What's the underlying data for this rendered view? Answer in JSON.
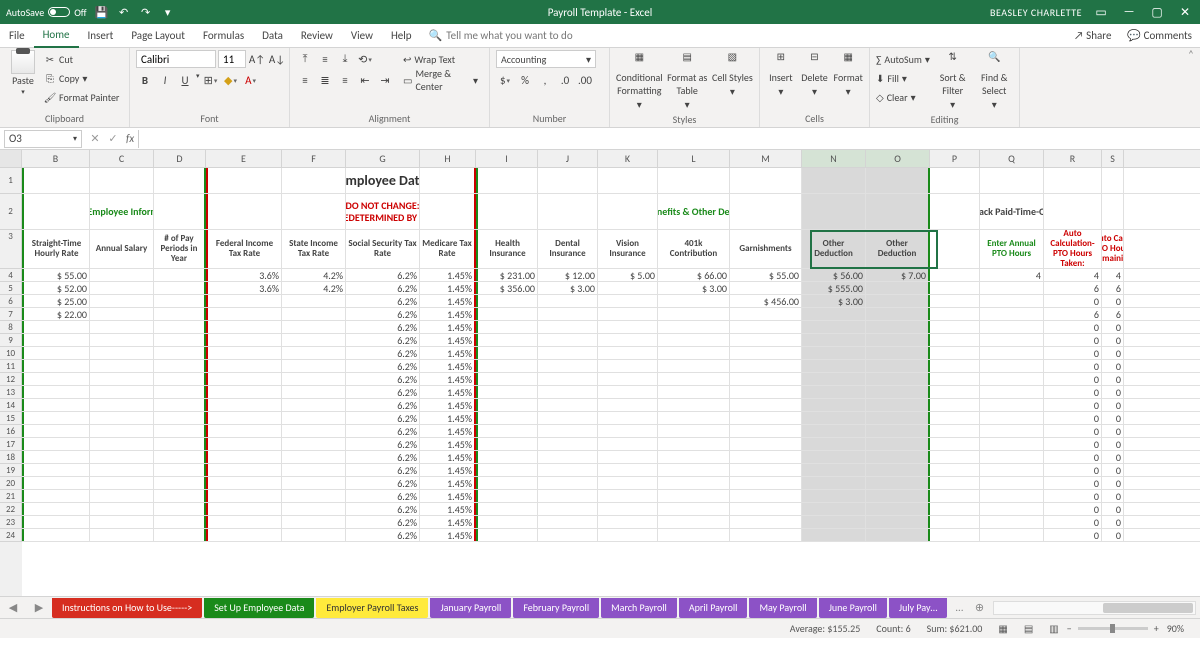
{
  "titlebar": {
    "autosave": "AutoSave",
    "off": "Off",
    "title": "Payroll Template - Excel",
    "user": "BEASLEY CHARLETTE"
  },
  "menu": {
    "file": "File",
    "home": "Home",
    "insert": "Insert",
    "pagelayout": "Page Layout",
    "formulas": "Formulas",
    "data": "Data",
    "review": "Review",
    "view": "View",
    "help": "Help",
    "tell": "Tell me what you want to do",
    "share": "Share",
    "comments": "Comments"
  },
  "ribbon": {
    "clipboard": "Clipboard",
    "paste": "Paste",
    "cut": "Cut",
    "copy": "Copy",
    "fmtpainter": "Format Painter",
    "font": "Font",
    "fontname": "Calibri",
    "fontsize": "11",
    "alignment": "Alignment",
    "wrap": "Wrap Text",
    "merge": "Merge & Center",
    "number": "Number",
    "numfmt": "Accounting",
    "styles": "Styles",
    "cond": "Conditional Formatting",
    "fat": "Format as Table",
    "cstyles": "Cell Styles",
    "cells": "Cells",
    "insert": "Insert",
    "delete": "Delete",
    "format": "Format",
    "editing": "Editing",
    "autosum": "AutoSum",
    "fill": "Fill",
    "clear": "Clear",
    "sort": "Sort & Filter",
    "find": "Find & Select"
  },
  "formula": {
    "name": "O3"
  },
  "cols": [
    "B",
    "C",
    "D",
    "E",
    "F",
    "G",
    "H",
    "I",
    "J",
    "K",
    "L",
    "M",
    "N",
    "O",
    "P",
    "Q",
    "R",
    "S"
  ],
  "headers": {
    "title": "Employee Data",
    "enter_emp": "Enter Employee Information",
    "dnc1": "DO NOT CHANGE:",
    "dnc2": "PREDETERMINED BY IRS",
    "enter_ben": "Enter Benefits & Other Deductions",
    "track_pto": "Track Paid-Time-Off",
    "B": "Straight-Time Hourly Rate",
    "C": "Annual Salary",
    "D": "# of Pay Periods in Year",
    "E": "Federal Income Tax Rate",
    "F": "State Income Tax Rate",
    "G": "Social Security Tax Rate",
    "H": "Medicare Tax Rate",
    "I": "Health Insurance",
    "J": "Dental Insurance",
    "K": "Vision Insurance",
    "L": "401k Contribution",
    "M": "Garnishments",
    "N": "Other Deduction",
    "O": "Other Deduction",
    "P": "",
    "Q": "Enter Annual PTO Hours",
    "R": "Auto Calculation- PTO Hours Taken:",
    "S": "Auto Calc- PTO Hours Remaining"
  },
  "rows": [
    {
      "B": "$      55.00",
      "E": "3.6%",
      "F": "4.2%",
      "G": "6.2%",
      "H": "1.45%",
      "I": "$      231.00",
      "J": "$       12.00",
      "K": "$         5.00",
      "L": "$       66.00",
      "M": "$       55.00",
      "N": "$       56.00",
      "O": "$         7.00",
      "Q": "4",
      "R": "4",
      "S": "4"
    },
    {
      "B": "$      52.00",
      "E": "3.6%",
      "F": "4.2%",
      "G": "6.2%",
      "H": "1.45%",
      "I": "$      356.00",
      "J": "$         3.00",
      "L": "$         3.00",
      "N": "$      555.00",
      "Q": "",
      "R": "6",
      "S": "6"
    },
    {
      "B": "$      25.00",
      "G": "6.2%",
      "H": "1.45%",
      "M": "$      456.00",
      "N": "$         3.00",
      "R": "0",
      "S": "0"
    },
    {
      "B": "$      22.00",
      "G": "6.2%",
      "H": "1.45%",
      "R": "6",
      "S": "6"
    },
    {
      "G": "6.2%",
      "H": "1.45%",
      "R": "0",
      "S": "0"
    },
    {
      "G": "6.2%",
      "H": "1.45%",
      "R": "0",
      "S": "0"
    },
    {
      "G": "6.2%",
      "H": "1.45%",
      "R": "0",
      "S": "0"
    },
    {
      "G": "6.2%",
      "H": "1.45%",
      "R": "0",
      "S": "0"
    },
    {
      "G": "6.2%",
      "H": "1.45%",
      "R": "0",
      "S": "0"
    },
    {
      "G": "6.2%",
      "H": "1.45%",
      "R": "0",
      "S": "0"
    },
    {
      "G": "6.2%",
      "H": "1.45%",
      "R": "0",
      "S": "0"
    },
    {
      "G": "6.2%",
      "H": "1.45%",
      "R": "0",
      "S": "0"
    },
    {
      "G": "6.2%",
      "H": "1.45%",
      "R": "0",
      "S": "0"
    },
    {
      "G": "6.2%",
      "H": "1.45%",
      "R": "0",
      "S": "0"
    },
    {
      "G": "6.2%",
      "H": "1.45%",
      "R": "0",
      "S": "0"
    },
    {
      "G": "6.2%",
      "H": "1.45%",
      "R": "0",
      "S": "0"
    },
    {
      "G": "6.2%",
      "H": "1.45%",
      "R": "0",
      "S": "0"
    },
    {
      "G": "6.2%",
      "H": "1.45%",
      "R": "0",
      "S": "0"
    },
    {
      "G": "6.2%",
      "H": "1.45%",
      "R": "0",
      "S": "0"
    },
    {
      "G": "6.2%",
      "H": "1.45%",
      "R": "0",
      "S": "0"
    },
    {
      "G": "6.2%",
      "H": "1.45%",
      "R": "0",
      "S": "0"
    }
  ],
  "tabs": [
    {
      "label": "Instructions on How to Use----->",
      "bg": "#d62d20"
    },
    {
      "label": "Set Up Employee Data",
      "bg": "#1a8a1a"
    },
    {
      "label": "Employer Payroll Taxes",
      "bg": "#ffea3c",
      "fg": "#333"
    },
    {
      "label": "January Payroll",
      "bg": "#8c52c6"
    },
    {
      "label": "February Payroll",
      "bg": "#8c52c6"
    },
    {
      "label": "March Payroll",
      "bg": "#8c52c6"
    },
    {
      "label": "April Payroll",
      "bg": "#8c52c6"
    },
    {
      "label": "May Payroll",
      "bg": "#8c52c6"
    },
    {
      "label": "June Payroll",
      "bg": "#8c52c6"
    },
    {
      "label": "July Pay…",
      "bg": "#8c52c6"
    }
  ],
  "status": {
    "avg": "Average: $155.25",
    "count": "Count: 6",
    "sum": "Sum: $621.00",
    "zoom": "90%"
  }
}
